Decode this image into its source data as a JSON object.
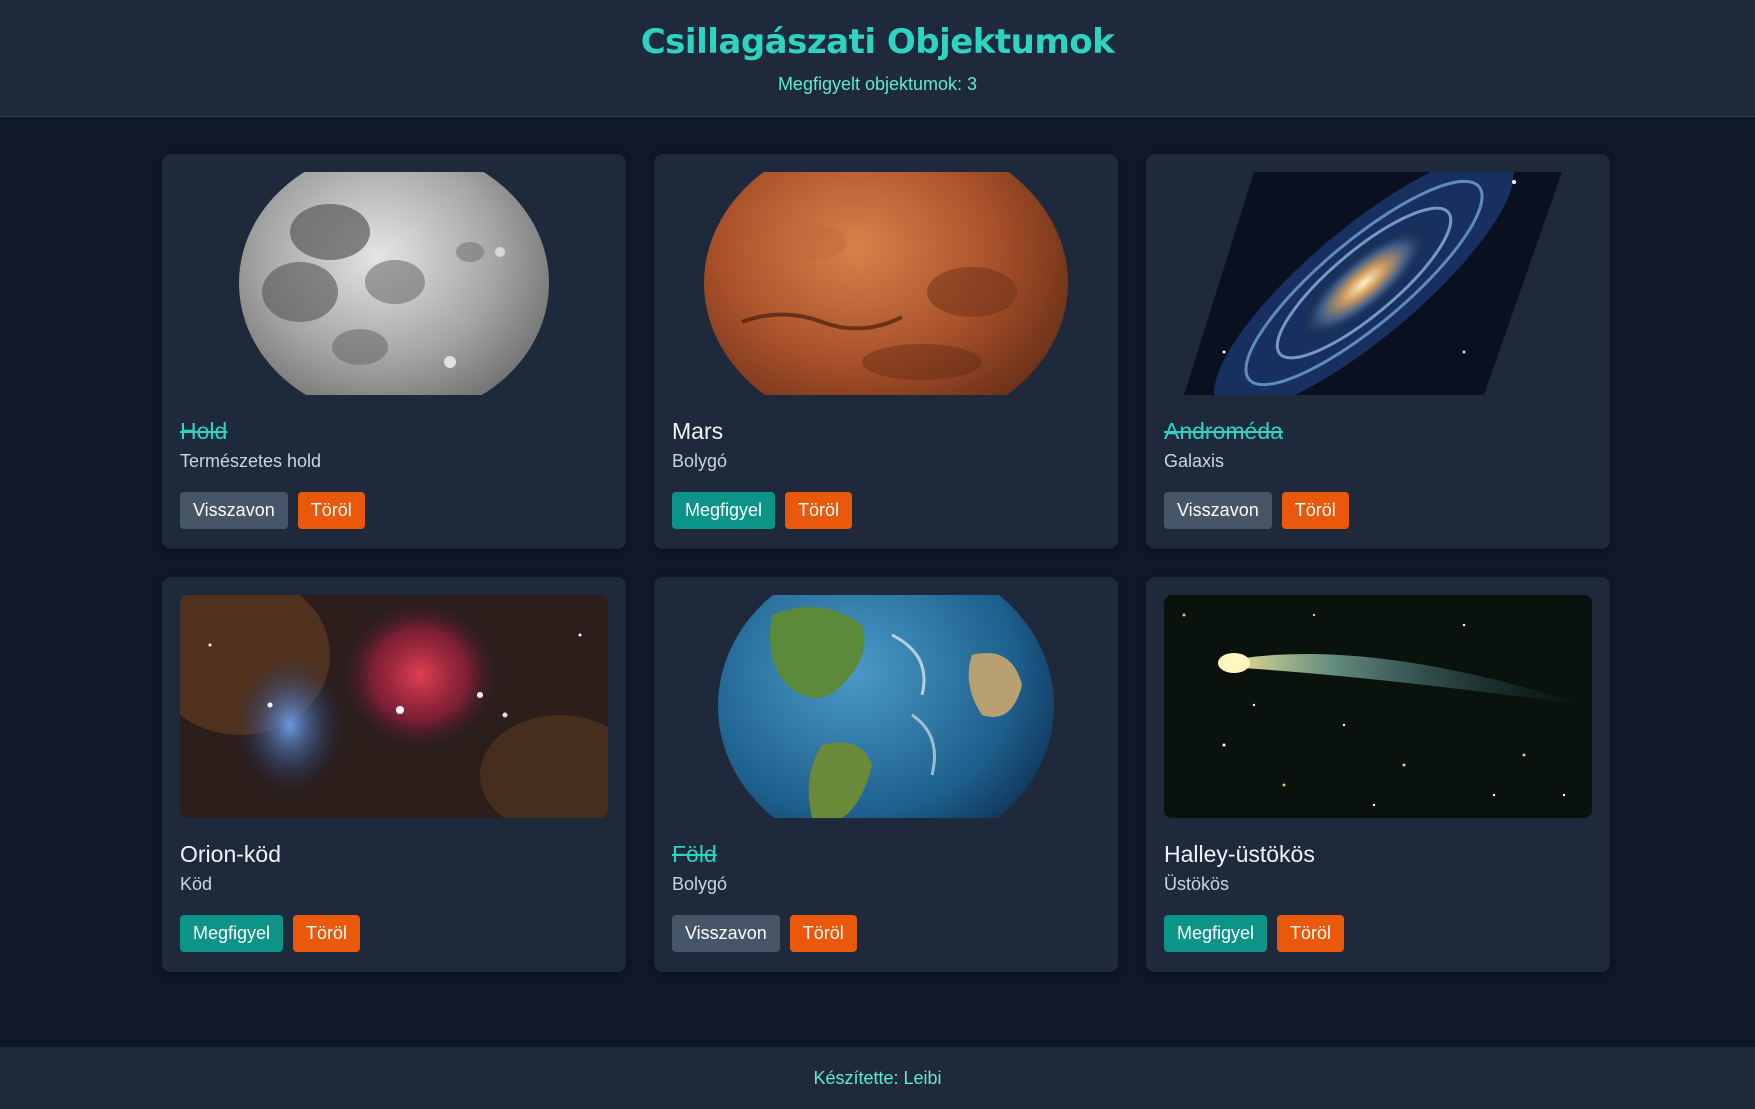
{
  "header": {
    "title": "Csillagászati Objektumok",
    "counter": "Megfigyelt objektumok: 3"
  },
  "objects": [
    {
      "name": "Hold",
      "type": "Természetes hold",
      "observed": true,
      "toggle_label": "Visszavon",
      "delete_label": "Töröl",
      "image": "moon"
    },
    {
      "name": "Mars",
      "type": "Bolygó",
      "observed": false,
      "toggle_label": "Megfigyel",
      "delete_label": "Töröl",
      "image": "mars"
    },
    {
      "name": "Androméda",
      "type": "Galaxis",
      "observed": true,
      "toggle_label": "Visszavon",
      "delete_label": "Töröl",
      "image": "galaxy"
    },
    {
      "name": "Orion-köd",
      "type": "Köd",
      "observed": false,
      "toggle_label": "Megfigyel",
      "delete_label": "Töröl",
      "image": "nebula"
    },
    {
      "name": "Föld",
      "type": "Bolygó",
      "observed": true,
      "toggle_label": "Visszavon",
      "delete_label": "Töröl",
      "image": "earth"
    },
    {
      "name": "Halley-üstökös",
      "type": "Üstökös",
      "observed": false,
      "toggle_label": "Megfigyel",
      "delete_label": "Töröl",
      "image": "comet"
    }
  ],
  "footer": {
    "credit": "Készítette: Leibi"
  },
  "colors": {
    "accent": "#2dd4bf",
    "observe": "#0d9488",
    "undo": "#475569",
    "delete": "#ea580c"
  }
}
